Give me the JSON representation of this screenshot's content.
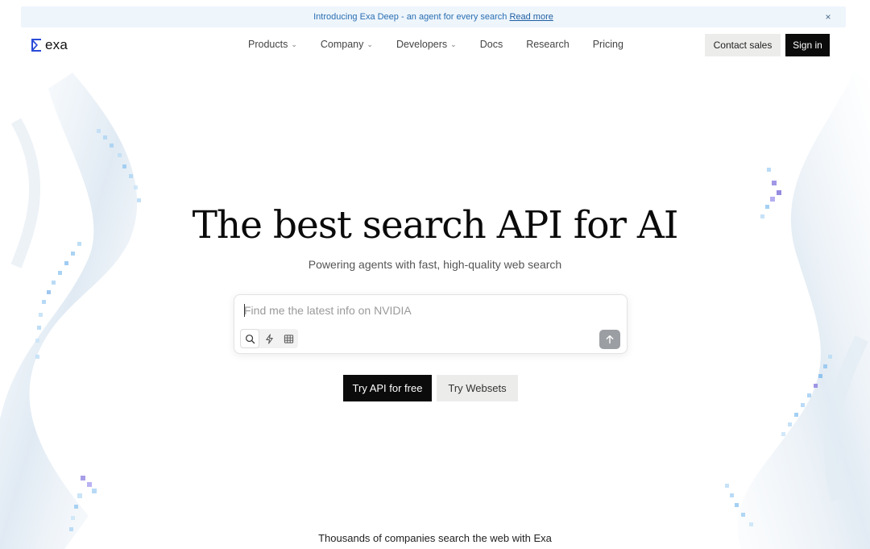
{
  "announcement": {
    "text": "Introducing Exa Deep - an agent for every search",
    "link_label": "Read more",
    "close_glyph": "×"
  },
  "brand": {
    "name": "exa",
    "logo_icon": "exa-logo-icon",
    "accent_color": "#2a4bd8"
  },
  "nav": {
    "items": [
      {
        "label": "Products",
        "dropdown": true
      },
      {
        "label": "Company",
        "dropdown": true
      },
      {
        "label": "Developers",
        "dropdown": true
      },
      {
        "label": "Docs",
        "dropdown": false
      },
      {
        "label": "Research",
        "dropdown": false
      },
      {
        "label": "Pricing",
        "dropdown": false
      }
    ],
    "chevron_glyph": "⌄",
    "contact_label": "Contact sales",
    "signin_label": "Sign in"
  },
  "hero": {
    "title": "The best search API for AI",
    "subtitle": "Powering agents with fast, high-quality web search"
  },
  "search": {
    "placeholder": "Find me the latest info on NVIDIA",
    "value": "",
    "modes": [
      {
        "icon": "search-icon",
        "active": true
      },
      {
        "icon": "lightning-icon",
        "active": false
      },
      {
        "icon": "table-grid-icon",
        "active": false
      }
    ],
    "submit_icon": "arrow-up-icon"
  },
  "cta": {
    "primary_label": "Try API for free",
    "secondary_label": "Try Websets"
  },
  "footer_line": "Thousands of companies search the web with Exa",
  "colors": {
    "primary_button": "#0b0b0b",
    "secondary_button": "#ececeb",
    "announcement_bg": "#eef5fb",
    "announcement_text": "#2a6fb3",
    "decor_blue": "#8ec5f0",
    "decor_purple": "#8a7ee0"
  }
}
